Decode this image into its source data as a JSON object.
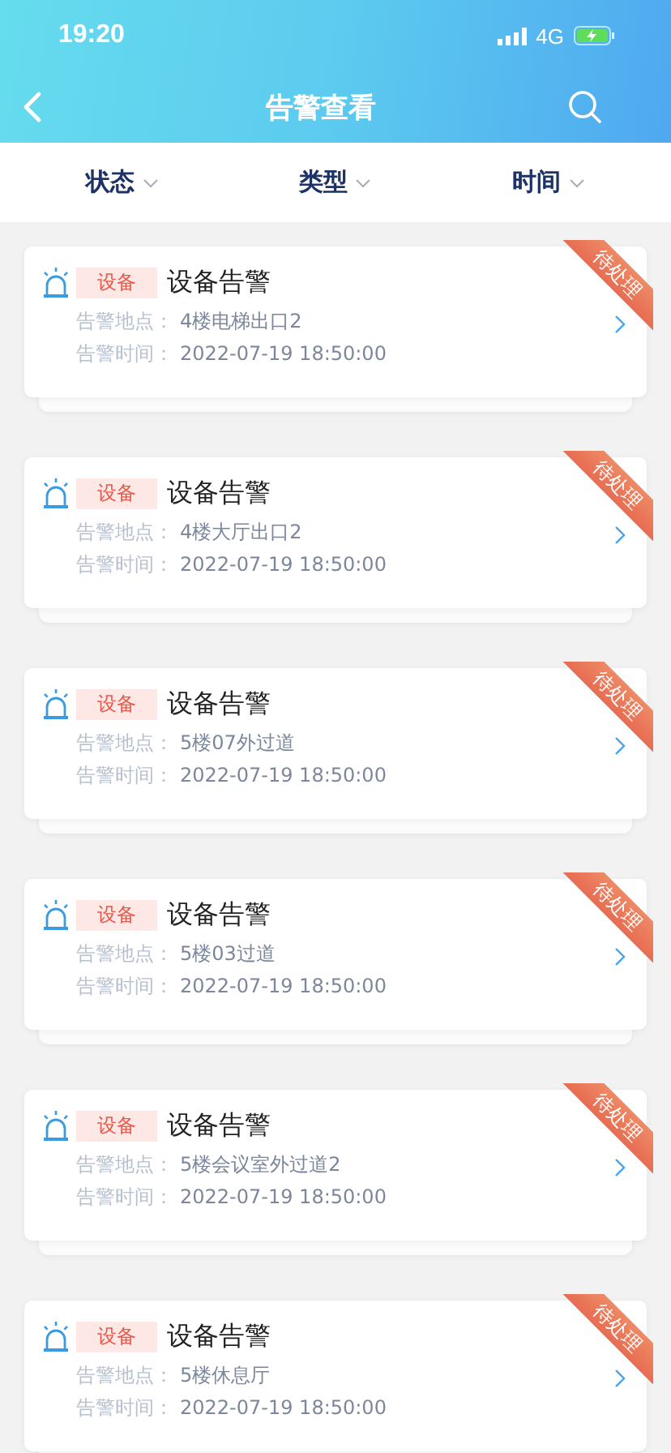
{
  "status_bar": {
    "time": "19:20",
    "network": "4G"
  },
  "nav": {
    "title": "告警查看"
  },
  "filters": [
    {
      "label": "状态"
    },
    {
      "label": "类型"
    },
    {
      "label": "时间"
    }
  ],
  "alarms": [
    {
      "tag": "设备",
      "title": "设备告警",
      "location_label": "告警地点：",
      "location": "4楼电梯出口2",
      "time_label": "告警时间：",
      "time": "2022-07-19 18:50:00",
      "status": "待处理"
    },
    {
      "tag": "设备",
      "title": "设备告警",
      "location_label": "告警地点：",
      "location": "4楼大厅出口2",
      "time_label": "告警时间：",
      "time": "2022-07-19 18:50:00",
      "status": "待处理"
    },
    {
      "tag": "设备",
      "title": "设备告警",
      "location_label": "告警地点：",
      "location": "5楼07外过道",
      "time_label": "告警时间：",
      "time": "2022-07-19 18:50:00",
      "status": "待处理"
    },
    {
      "tag": "设备",
      "title": "设备告警",
      "location_label": "告警地点：",
      "location": "5楼03过道",
      "time_label": "告警时间：",
      "time": "2022-07-19 18:50:00",
      "status": "待处理"
    },
    {
      "tag": "设备",
      "title": "设备告警",
      "location_label": "告警地点：",
      "location": "5楼会议室外过道2",
      "time_label": "告警时间：",
      "time": "2022-07-19 18:50:00",
      "status": "待处理"
    },
    {
      "tag": "设备",
      "title": "设备告警",
      "location_label": "告警地点：",
      "location": "5楼休息厅",
      "time_label": "告警时间：",
      "time": "2022-07-19 18:50:00",
      "status": "待处理"
    }
  ]
}
